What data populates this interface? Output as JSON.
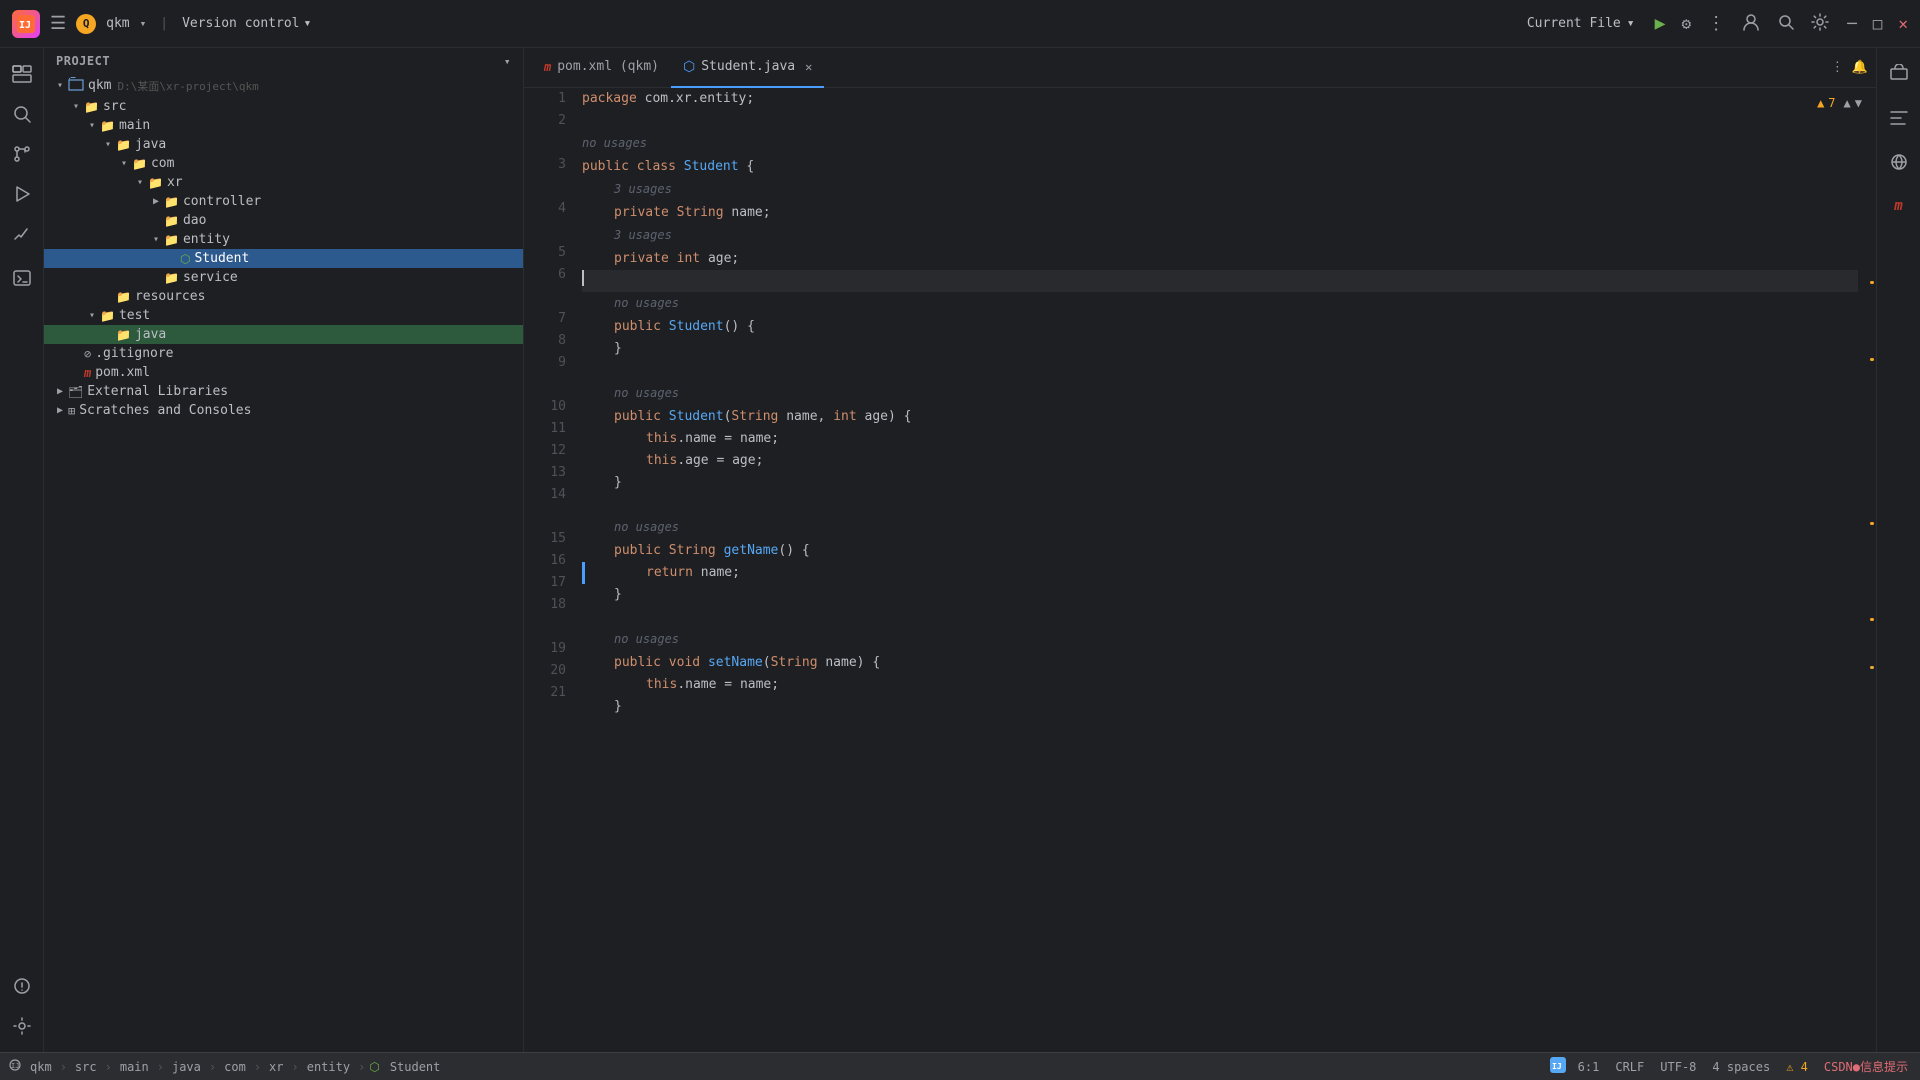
{
  "titlebar": {
    "logo_text": "IJ",
    "project_badge": "Q",
    "project_name": "qkm",
    "version_control_label": "Version control",
    "chevron": "▾",
    "current_file_label": "Current File",
    "run_icon": "▶",
    "debug_icon": "🐞",
    "more_icon": "⋮",
    "profile_icon": "👤",
    "search_icon": "🔍",
    "settings_icon": "⚙",
    "minimize": "─",
    "maximize": "□",
    "close": "✕"
  },
  "sidebar": {
    "header_label": "Project",
    "chevron": "▾",
    "items": [
      {
        "id": "qkm-root",
        "label": "qkm",
        "path": "D:\\某面\\xr-project\\qkm",
        "type": "root",
        "indent": 0,
        "expanded": true
      },
      {
        "id": "src",
        "label": "src",
        "type": "folder",
        "indent": 1,
        "expanded": true
      },
      {
        "id": "main",
        "label": "main",
        "type": "folder",
        "indent": 2,
        "expanded": true
      },
      {
        "id": "java",
        "label": "java",
        "type": "folder",
        "indent": 3,
        "expanded": true
      },
      {
        "id": "com",
        "label": "com",
        "type": "folder",
        "indent": 4,
        "expanded": true
      },
      {
        "id": "xr",
        "label": "xr",
        "type": "folder",
        "indent": 5,
        "expanded": true
      },
      {
        "id": "controller",
        "label": "controller",
        "type": "folder",
        "indent": 6,
        "expanded": false
      },
      {
        "id": "dao",
        "label": "dao",
        "type": "folder",
        "indent": 6,
        "expanded": false
      },
      {
        "id": "entity",
        "label": "entity",
        "type": "folder",
        "indent": 6,
        "expanded": true
      },
      {
        "id": "Student",
        "label": "Student",
        "type": "class",
        "indent": 7,
        "selected": true
      },
      {
        "id": "service",
        "label": "service",
        "type": "folder",
        "indent": 6,
        "expanded": false
      },
      {
        "id": "resources",
        "label": "resources",
        "type": "folder",
        "indent": 3,
        "expanded": false
      },
      {
        "id": "test",
        "label": "test",
        "type": "folder",
        "indent": 2,
        "expanded": true
      },
      {
        "id": "test-java",
        "label": "java",
        "type": "folder",
        "indent": 3,
        "expanded": false,
        "selected_green": true
      },
      {
        "id": "gitignore",
        "label": ".gitignore",
        "type": "gitignore",
        "indent": 1
      },
      {
        "id": "pom",
        "label": "pom.xml",
        "type": "pom",
        "indent": 1
      },
      {
        "id": "ext-libs",
        "label": "External Libraries",
        "type": "ext",
        "indent": 0,
        "expanded": false
      },
      {
        "id": "scratches",
        "label": "Scratches and Consoles",
        "type": "scratches",
        "indent": 0,
        "expanded": false
      }
    ]
  },
  "tabs": [
    {
      "id": "pom-tab",
      "label": "pom.xml (qkm)",
      "icon": "m",
      "type": "pom",
      "active": false
    },
    {
      "id": "student-tab",
      "label": "Student.java",
      "icon": "⬡",
      "type": "java",
      "active": true
    }
  ],
  "editor": {
    "warning_count": "▲ 7",
    "lines": [
      {
        "num": 1,
        "hint": "",
        "code": "package com.xr.entity;"
      },
      {
        "num": 2,
        "hint": "",
        "code": ""
      },
      {
        "num": 3,
        "hint": "no usages",
        "code": "public class Student {"
      },
      {
        "num": 4,
        "hint": "3 usages",
        "code": "    private String name;"
      },
      {
        "num": 5,
        "hint": "3 usages",
        "code": "    private int age;"
      },
      {
        "num": 6,
        "hint": "",
        "code": "",
        "cursor": true
      },
      {
        "num": 7,
        "hint": "no usages",
        "code": "    public Student() {"
      },
      {
        "num": 8,
        "hint": "",
        "code": "    }"
      },
      {
        "num": 9,
        "hint": "",
        "code": ""
      },
      {
        "num": 10,
        "hint": "no usages",
        "code": "    public Student(String name, int age) {"
      },
      {
        "num": 11,
        "hint": "",
        "code": "        this.name = name;"
      },
      {
        "num": 12,
        "hint": "",
        "code": "        this.age = age;"
      },
      {
        "num": 13,
        "hint": "",
        "code": "    }"
      },
      {
        "num": 14,
        "hint": "",
        "code": ""
      },
      {
        "num": 15,
        "hint": "no usages",
        "code": "    public String getName() {"
      },
      {
        "num": 16,
        "hint": "",
        "code": "        return name;",
        "border": true
      },
      {
        "num": 17,
        "hint": "",
        "code": "    }"
      },
      {
        "num": 18,
        "hint": "",
        "code": ""
      },
      {
        "num": 19,
        "hint": "no usages",
        "code": "    public void setName(String name) {"
      },
      {
        "num": 20,
        "hint": "",
        "code": "        this.name = name;"
      },
      {
        "num": 21,
        "hint": "",
        "code": "    }"
      }
    ]
  },
  "activity_icons": [
    "📁",
    "🔍",
    "⚡",
    "⋮"
  ],
  "right_icons": [
    "📋",
    "🌐",
    "m"
  ],
  "status_bar": {
    "project_name": "qkm",
    "sep1": ">",
    "src": "src",
    "sep2": ">",
    "main": "main",
    "sep3": ">",
    "java": "java",
    "sep4": ">",
    "com": "com",
    "sep5": ">",
    "xr": "xr",
    "sep6": ">",
    "entity": "entity",
    "sep7": ">",
    "student": "Student",
    "cursor_pos": "6:1",
    "line_ending": "CRLF",
    "encoding": "UTF-8",
    "indent": "4",
    "warning_text": "4",
    "warning_label": "CSDNQ信息提示"
  }
}
